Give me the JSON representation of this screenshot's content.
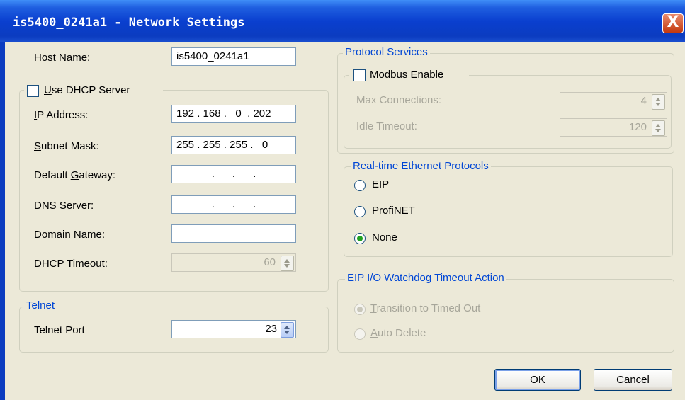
{
  "window": {
    "title": "is5400_0241a1 - Network Settings",
    "close_glyph": "X"
  },
  "left": {
    "host_name": {
      "pre": "",
      "ul": "H",
      "post": "ost Name:",
      "value": "is5400_0241a1"
    },
    "use_dhcp": {
      "pre": "",
      "ul": "U",
      "post": "se DHCP Server",
      "checked": false
    },
    "ip_address": {
      "pre": "",
      "ul": "I",
      "post": "P Address:",
      "value": "192 . 168 .   0  . 202"
    },
    "subnet_mask": {
      "pre": "",
      "ul": "S",
      "post": "ubnet Mask:",
      "value": "255 . 255 . 255 .   0"
    },
    "default_gateway": {
      "pre": "Default ",
      "ul": "G",
      "post": "ateway:",
      "value": "  .      .      .  "
    },
    "dns_server": {
      "pre": "",
      "ul": "D",
      "post": "NS Server:",
      "value": "  .      .      .  "
    },
    "domain_name": {
      "pre": "D",
      "ul": "o",
      "post": "main Name:",
      "value": ""
    },
    "dhcp_timeout": {
      "pre": "DHCP ",
      "ul": "T",
      "post": "imeout:",
      "value": "60"
    },
    "telnet": {
      "group_title": "Telnet",
      "port_label": "Telnet Port",
      "port_value": "23"
    }
  },
  "right": {
    "protocol_services": {
      "group_title": "Protocol Services",
      "modbus_label": "Modbus Enable",
      "modbus_checked": false,
      "max_connections_label": "Max Connections:",
      "max_connections_value": "4",
      "idle_timeout_label": "Idle Timeout:",
      "idle_timeout_value": "120"
    },
    "realtime": {
      "group_title": "Real-time Ethernet Protocols",
      "options": [
        "EIP",
        "ProfiNET",
        "None"
      ],
      "selected": "None"
    },
    "watchdog": {
      "group_title": "EIP I/O Watchdog Timeout Action",
      "opt1": {
        "pre": "",
        "ul": "T",
        "post": "ransition to Timed Out"
      },
      "opt2": {
        "pre": "",
        "ul": "A",
        "post": "uto Delete"
      },
      "selected": "Transition to Timed Out"
    }
  },
  "buttons": {
    "ok": "OK",
    "cancel": "Cancel"
  },
  "colors": {
    "title_bar": "#0b3cc0",
    "dialog_bg": "#ece9d8",
    "group_title": "#0046d5",
    "disabled_text": "#a7a69a"
  }
}
